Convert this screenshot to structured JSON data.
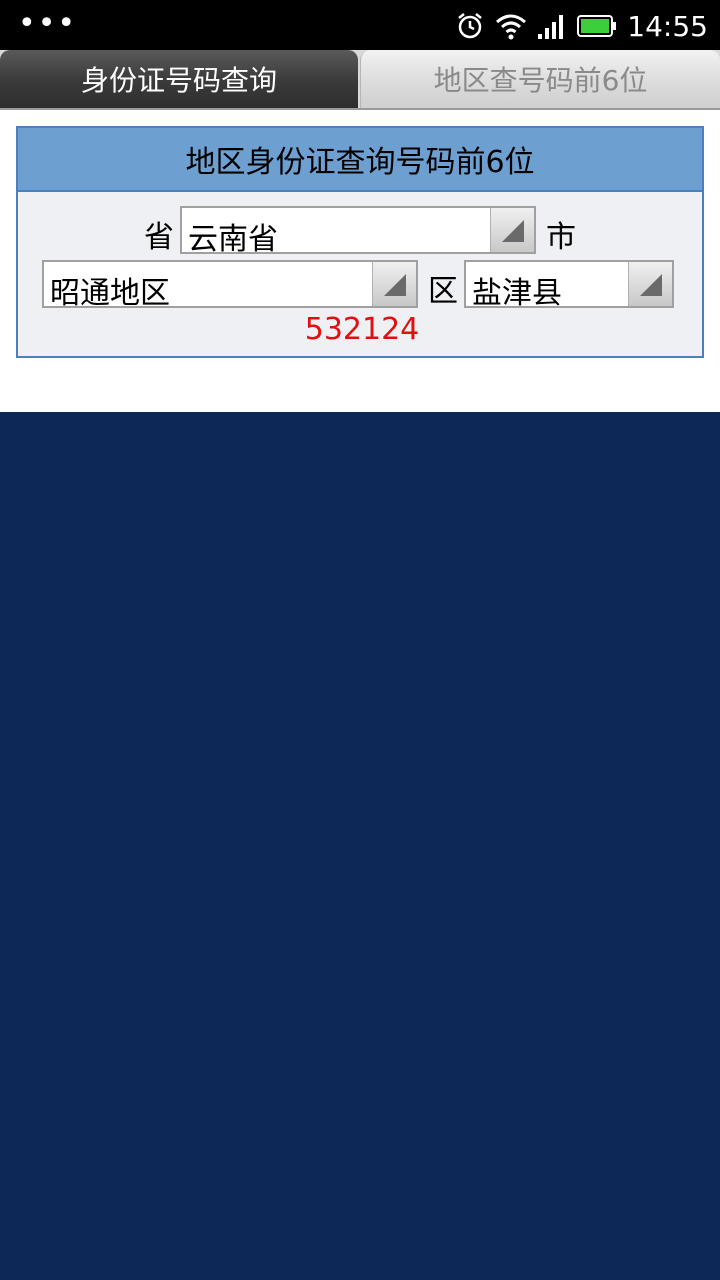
{
  "status_bar": {
    "time": "14:55",
    "notification_dots": "•••",
    "icons": [
      "alarm-icon",
      "wifi-icon",
      "signal-icon",
      "battery-icon"
    ]
  },
  "tabs": [
    {
      "label": "身份证号码查询",
      "active": true
    },
    {
      "label": "地区查号码前6位",
      "active": false
    }
  ],
  "panel": {
    "title": "地区身份证查询号码前6位",
    "province_label": "省",
    "province_value": "云南省",
    "city_label": "市",
    "city_value": "昭通地区",
    "district_label": "区",
    "district_value": "盐津县",
    "result_code": "532124"
  },
  "colors": {
    "header_bg": "#6e9fd1",
    "panel_border": "#4a7fc0",
    "result_red": "#e01010",
    "background_navy": "#0d2857"
  }
}
